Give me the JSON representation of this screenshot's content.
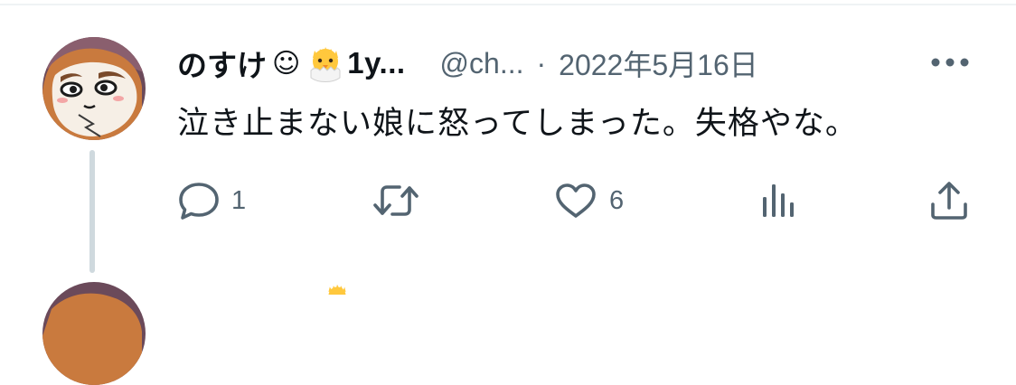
{
  "tweet": {
    "display_name": "のすけ",
    "smile_emoji": "☺",
    "name_tail": "1y...",
    "handle": "@ch...",
    "separator": "·",
    "date": "2022年5月16日",
    "text": "泣き止まない娘に怒ってしまった。失格やな。",
    "actions": {
      "reply_count": "1",
      "like_count": "6"
    }
  },
  "icons": [
    "chick-emoji-icon",
    "more-icon",
    "reply-icon",
    "retweet-icon",
    "like-icon",
    "analytics-icon",
    "share-icon"
  ],
  "colors": {
    "text_primary": "#0f1419",
    "text_secondary": "#536471",
    "thread_line": "#cfd9de",
    "divider": "#eff3f4"
  }
}
